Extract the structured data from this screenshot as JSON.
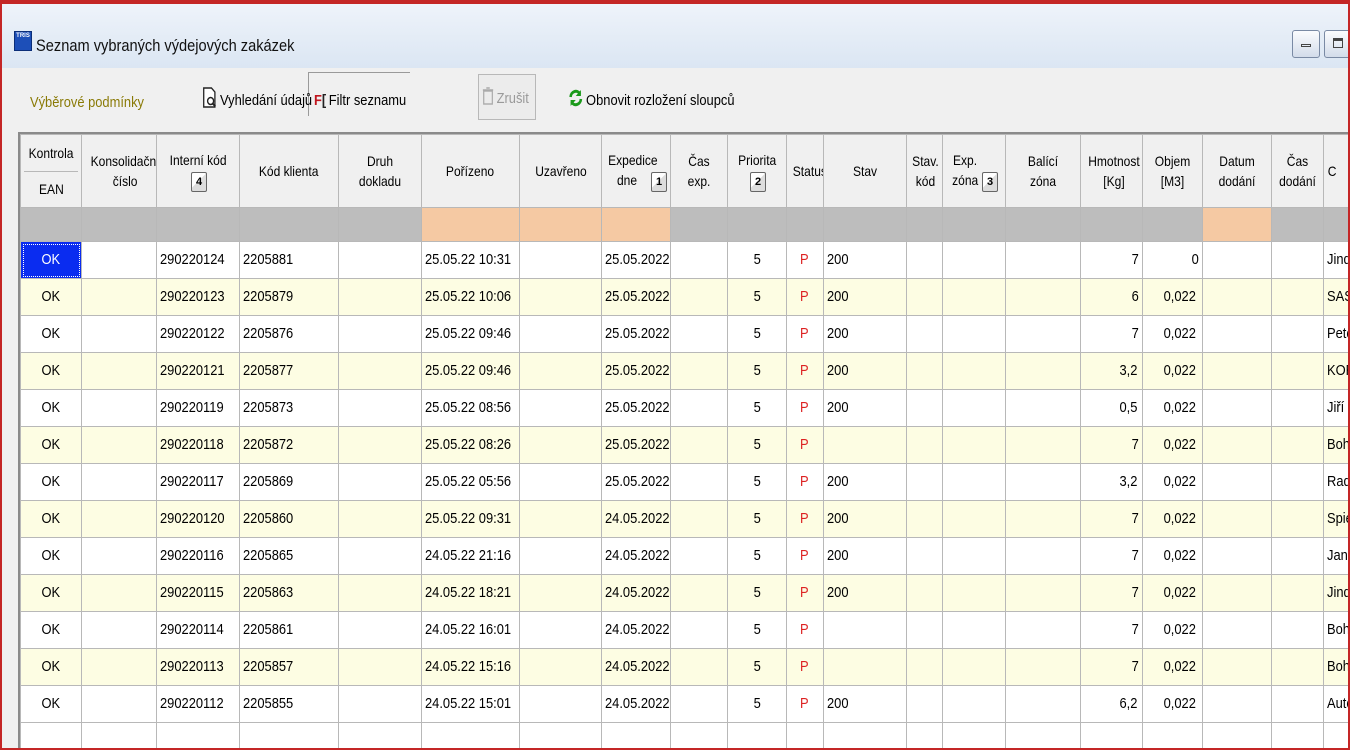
{
  "window": {
    "title": "Seznam vybraných výdejových zakázek",
    "logo_text": "TRIS"
  },
  "toolbar": {
    "selection_conditions": "Výběrové podmínky",
    "search_data": "Vyhledání údajů",
    "filter_list": "Filtr seznamu",
    "cancel": "Zrušit",
    "refresh_columns": "Obnovit rozložení sloupců"
  },
  "grid": {
    "columns": {
      "kontrola": "Kontrola",
      "ean": "EAN",
      "konsolidacni_cislo": "Konsolidační číslo",
      "interni_kod": "Interní kód",
      "interni_kod_sort": "4",
      "kod_klienta": "Kód klienta",
      "druh_dokladu": "Druh dokladu",
      "porizeno": "Pořízeno",
      "uzavreno": "Uzavřeno",
      "expedice_dne": "Expedice dne",
      "expedice_dne_sort": "1",
      "cas_exp": "Čas exp.",
      "priorita": "Priorita",
      "priorita_sort": "2",
      "status": "Status",
      "stav": "Stav",
      "stav_kod": "Stav. kód",
      "exp_zona": "Exp. zóna",
      "exp_zona_sort": "3",
      "balici_zona": "Balící zóna",
      "hmotnost": "Hmotnost [Kg]",
      "objem": "Objem [M3]",
      "datum_dodani": "Datum dodání",
      "cas_dodani": "Čas dodání",
      "klient_partial": "C"
    },
    "rows": [
      {
        "kontrola": "OK",
        "interni": "290220124",
        "klient": "2205881",
        "porizeno": "25.05.22 10:31",
        "expedice": "25.05.2022",
        "priorita": "5",
        "status": "P",
        "stav": "200",
        "hmotnost": "7",
        "objem": "0",
        "nazev": "Jindřic"
      },
      {
        "kontrola": "OK",
        "interni": "290220123",
        "klient": "2205879",
        "porizeno": "25.05.22 10:06",
        "expedice": "25.05.2022",
        "priorita": "5",
        "status": "P",
        "stav": "200",
        "hmotnost": "6",
        "objem": "0,022",
        "nazev": "SAS R"
      },
      {
        "kontrola": "OK",
        "interni": "290220122",
        "klient": "2205876",
        "porizeno": "25.05.22 09:46",
        "expedice": "25.05.2022",
        "priorita": "5",
        "status": "P",
        "stav": "200",
        "hmotnost": "7",
        "objem": "0,022",
        "nazev": "Peter"
      },
      {
        "kontrola": "OK",
        "interni": "290220121",
        "klient": "2205877",
        "porizeno": "25.05.22 09:46",
        "expedice": "25.05.2022",
        "priorita": "5",
        "status": "P",
        "stav": "200",
        "hmotnost": "3,2",
        "objem": "0,022",
        "nazev": "KORU"
      },
      {
        "kontrola": "OK",
        "interni": "290220119",
        "klient": "2205873",
        "porizeno": "25.05.22 08:56",
        "expedice": "25.05.2022",
        "priorita": "5",
        "status": "P",
        "stav": "200",
        "hmotnost": "0,5",
        "objem": "0,022",
        "nazev": "Jiří Ča"
      },
      {
        "kontrola": "OK",
        "interni": "290220118",
        "klient": "2205872",
        "porizeno": "25.05.22 08:26",
        "expedice": "25.05.2022",
        "priorita": "5",
        "status": "P",
        "stav": "",
        "hmotnost": "7",
        "objem": "0,022",
        "nazev": "Bohda"
      },
      {
        "kontrola": "OK",
        "interni": "290220117",
        "klient": "2205869",
        "porizeno": "25.05.22 05:56",
        "expedice": "25.05.2022",
        "priorita": "5",
        "status": "P",
        "stav": "200",
        "hmotnost": "3,2",
        "objem": "0,022",
        "nazev": "Radm"
      },
      {
        "kontrola": "OK",
        "interni": "290220120",
        "klient": "2205860",
        "porizeno": "25.05.22 09:31",
        "expedice": "24.05.2022",
        "priorita": "5",
        "status": "P",
        "stav": "200",
        "hmotnost": "7",
        "objem": "0,022",
        "nazev": "Spieg"
      },
      {
        "kontrola": "OK",
        "interni": "290220116",
        "klient": "2205865",
        "porizeno": "24.05.22 21:16",
        "expedice": "24.05.2022",
        "priorita": "5",
        "status": "P",
        "stav": "200",
        "hmotnost": "7",
        "objem": "0,022",
        "nazev": "Jan V"
      },
      {
        "kontrola": "OK",
        "interni": "290220115",
        "klient": "2205863",
        "porizeno": "24.05.22 18:21",
        "expedice": "24.05.2022",
        "priorita": "5",
        "status": "P",
        "stav": "200",
        "hmotnost": "7",
        "objem": "0,022",
        "nazev": "Jindřic"
      },
      {
        "kontrola": "OK",
        "interni": "290220114",
        "klient": "2205861",
        "porizeno": "24.05.22 16:01",
        "expedice": "24.05.2022",
        "priorita": "5",
        "status": "P",
        "stav": "",
        "hmotnost": "7",
        "objem": "0,022",
        "nazev": "Bohda"
      },
      {
        "kontrola": "OK",
        "interni": "290220113",
        "klient": "2205857",
        "porizeno": "24.05.22 15:16",
        "expedice": "24.05.2022",
        "priorita": "5",
        "status": "P",
        "stav": "",
        "hmotnost": "7",
        "objem": "0,022",
        "nazev": "Bohda"
      },
      {
        "kontrola": "OK",
        "interni": "290220112",
        "klient": "2205855",
        "porizeno": "24.05.22 15:01",
        "expedice": "24.05.2022",
        "priorita": "5",
        "status": "P",
        "stav": "200",
        "hmotnost": "6,2",
        "objem": "0,022",
        "nazev": "Auto"
      }
    ]
  },
  "colors": {
    "selected_cell": "#0a2cf0",
    "alt_row": "#fdfde3",
    "filter_row": "#bdbdbd",
    "filter_peach": "#f5c9a3",
    "status_text": "#d22222",
    "window_border": "#c42626"
  }
}
